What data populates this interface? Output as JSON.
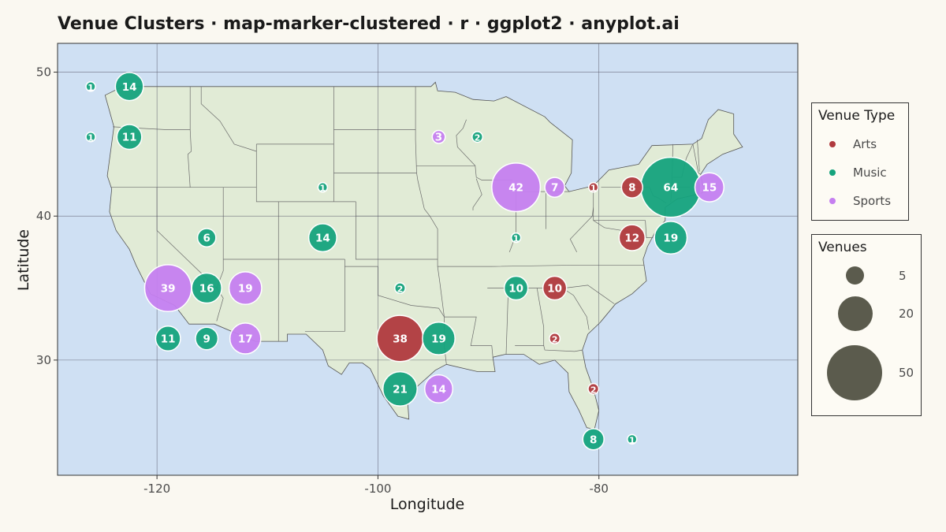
{
  "title": "Venue Clusters · map-marker-clustered · r · ggplot2 · anyplot.ai",
  "colors": {
    "background": "#faf8f1",
    "ocean": "#cfe0f3",
    "land": "#e1ebd6",
    "border": "#555555",
    "Arts": "#b03a3e",
    "Music": "#15a37d",
    "Sports": "#c57ff0",
    "size_legend": "#5b5b4d"
  },
  "chart_data": {
    "type": "scatter",
    "title": "Venue Clusters · map-marker-clustered · r · ggplot2 · anyplot.ai",
    "xlabel": "Longitude",
    "ylabel": "Latitude",
    "xlim": [
      -129,
      -62
    ],
    "ylim": [
      22,
      52
    ],
    "x_ticks": [
      -120,
      -100,
      -80
    ],
    "y_ticks": [
      30,
      40,
      50
    ],
    "grid": true,
    "legend_color": {
      "title": "Venue Type",
      "entries": [
        "Arts",
        "Music",
        "Sports"
      ],
      "placement": "right"
    },
    "legend_size": {
      "title": "Venues",
      "entries": [
        5,
        20,
        50
      ],
      "placement": "right"
    },
    "markers": [
      {
        "lon": -126.0,
        "lat": 49.0,
        "count": 1,
        "type": "Music"
      },
      {
        "lon": -122.5,
        "lat": 49.0,
        "count": 14,
        "type": "Music"
      },
      {
        "lon": -126.0,
        "lat": 45.5,
        "count": 1,
        "type": "Music"
      },
      {
        "lon": -122.5,
        "lat": 45.5,
        "count": 11,
        "type": "Music"
      },
      {
        "lon": -115.5,
        "lat": 38.5,
        "count": 6,
        "type": "Music"
      },
      {
        "lon": -105.0,
        "lat": 38.5,
        "count": 14,
        "type": "Music"
      },
      {
        "lon": -105.0,
        "lat": 42.0,
        "count": 1,
        "type": "Music"
      },
      {
        "lon": -119.0,
        "lat": 35.0,
        "count": 39,
        "type": "Sports"
      },
      {
        "lon": -115.5,
        "lat": 35.0,
        "count": 16,
        "type": "Music"
      },
      {
        "lon": -112.0,
        "lat": 35.0,
        "count": 19,
        "type": "Sports"
      },
      {
        "lon": -119.0,
        "lat": 31.5,
        "count": 11,
        "type": "Music"
      },
      {
        "lon": -115.5,
        "lat": 31.5,
        "count": 9,
        "type": "Music"
      },
      {
        "lon": -112.0,
        "lat": 31.5,
        "count": 17,
        "type": "Sports"
      },
      {
        "lon": -98.0,
        "lat": 35.0,
        "count": 2,
        "type": "Music"
      },
      {
        "lon": -98.0,
        "lat": 31.5,
        "count": 38,
        "type": "Arts"
      },
      {
        "lon": -94.5,
        "lat": 31.5,
        "count": 19,
        "type": "Music"
      },
      {
        "lon": -98.0,
        "lat": 28.0,
        "count": 21,
        "type": "Music"
      },
      {
        "lon": -94.5,
        "lat": 28.0,
        "count": 14,
        "type": "Sports"
      },
      {
        "lon": -94.5,
        "lat": 45.5,
        "count": 3,
        "type": "Sports"
      },
      {
        "lon": -91.0,
        "lat": 45.5,
        "count": 2,
        "type": "Music"
      },
      {
        "lon": -87.5,
        "lat": 42.0,
        "count": 42,
        "type": "Sports"
      },
      {
        "lon": -84.0,
        "lat": 42.0,
        "count": 7,
        "type": "Sports"
      },
      {
        "lon": -80.5,
        "lat": 42.0,
        "count": 1,
        "type": "Arts"
      },
      {
        "lon": -77.0,
        "lat": 42.0,
        "count": 8,
        "type": "Arts"
      },
      {
        "lon": -73.5,
        "lat": 42.0,
        "count": 64,
        "type": "Music"
      },
      {
        "lon": -70.0,
        "lat": 42.0,
        "count": 15,
        "type": "Sports"
      },
      {
        "lon": -87.5,
        "lat": 38.5,
        "count": 1,
        "type": "Music"
      },
      {
        "lon": -77.0,
        "lat": 38.5,
        "count": 12,
        "type": "Arts"
      },
      {
        "lon": -73.5,
        "lat": 38.5,
        "count": 19,
        "type": "Music"
      },
      {
        "lon": -87.5,
        "lat": 35.0,
        "count": 10,
        "type": "Music"
      },
      {
        "lon": -84.0,
        "lat": 35.0,
        "count": 10,
        "type": "Arts"
      },
      {
        "lon": -84.0,
        "lat": 31.5,
        "count": 2,
        "type": "Arts"
      },
      {
        "lon": -80.5,
        "lat": 28.0,
        "count": 2,
        "type": "Arts"
      },
      {
        "lon": -80.5,
        "lat": 24.5,
        "count": 8,
        "type": "Music"
      },
      {
        "lon": -77.0,
        "lat": 24.5,
        "count": 1,
        "type": "Music"
      }
    ]
  }
}
